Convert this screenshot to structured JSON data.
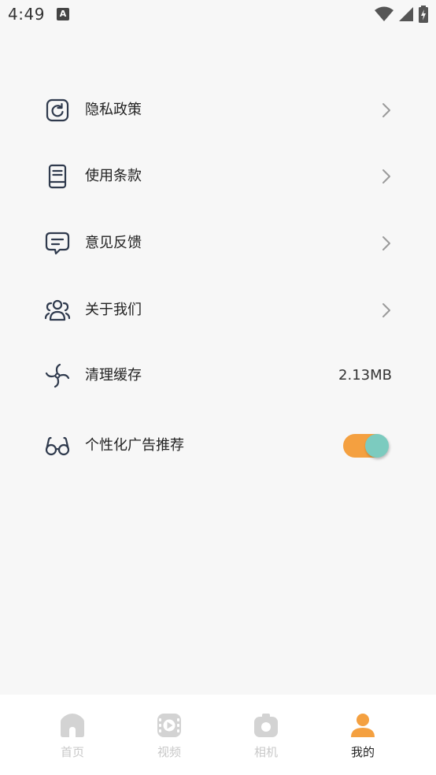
{
  "status_bar": {
    "time": "4:49",
    "app_indicator": "A"
  },
  "settings": {
    "items": [
      {
        "label": "隐私政策",
        "icon": "refresh-square-icon",
        "type": "link"
      },
      {
        "label": "使用条款",
        "icon": "document-icon",
        "type": "link"
      },
      {
        "label": "意见反馈",
        "icon": "chat-bubble-icon",
        "type": "link"
      },
      {
        "label": "关于我们",
        "icon": "group-icon",
        "type": "link"
      },
      {
        "label": "清理缓存",
        "icon": "fan-icon",
        "type": "value",
        "value": "2.13MB"
      },
      {
        "label": "个性化广告推荐",
        "icon": "glasses-icon",
        "type": "toggle",
        "toggle_on": true
      }
    ]
  },
  "bottom_nav": {
    "items": [
      {
        "label": "首页",
        "icon": "home-icon",
        "active": false
      },
      {
        "label": "视频",
        "icon": "video-icon",
        "active": false
      },
      {
        "label": "相机",
        "icon": "camera-icon",
        "active": false
      },
      {
        "label": "我的",
        "icon": "profile-icon",
        "active": true
      }
    ]
  },
  "colors": {
    "accent_orange": "#f4a040",
    "toggle_knob": "#7ccbbf",
    "icon_stroke": "#2f3a4d",
    "inactive_nav": "#d0d0d0",
    "background": "#f7f7f7"
  }
}
